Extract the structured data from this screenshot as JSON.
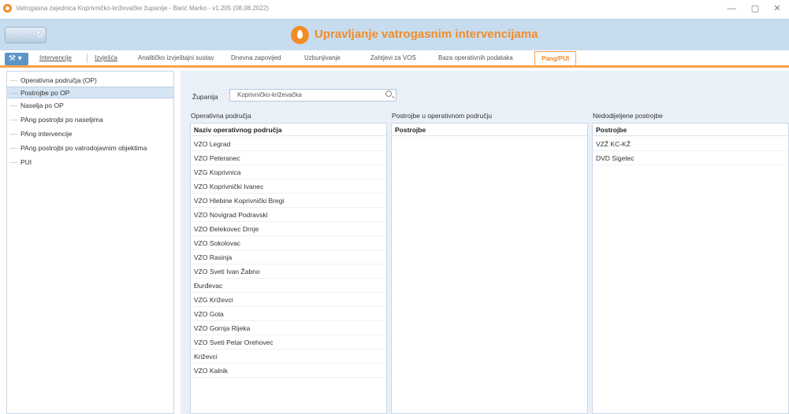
{
  "window": {
    "title": "Vatrogasna zajednica Koprivničko-križevačke županije - Barić Marko - v1.205 (08.08.2022)",
    "minimize": "—",
    "maximize": "▢",
    "close": "✕"
  },
  "header": {
    "back": "←",
    "forward": "→",
    "refresh": "↻",
    "title": "Upravljanje vatrogasnim intervencijama"
  },
  "tabs": {
    "tools": "⚒ ▾",
    "items": [
      "Intervencije",
      "Izvješća",
      "Analitičko izvještajni sustav",
      "Dnevna zapovijed",
      "Uzbunjivanje",
      "Zahtjevi za VOS",
      "Baza operativnih podataka",
      "Pang/PUI"
    ]
  },
  "sidebar": {
    "items": [
      "Operativna područja (OP)",
      "Postrojbe po OP",
      "Naselja po OP",
      "PAng postrojbi po naseljima",
      "PAng intervencije",
      "PAng postrojbi po vatrodojavnim objektima",
      "PUI"
    ]
  },
  "filter": {
    "label": "Županija",
    "value": "Koprivničko-križevačka"
  },
  "panels": {
    "areas": {
      "label": "Operativna područja",
      "header": "Naziv operativnog područja",
      "rows": [
        "VZO Legrad",
        "VZO Peteranec",
        "VZG Koprivnica",
        "VZO Koprivnički Ivanec",
        "VZO Hlebine Koprivnički Bregi",
        "VZO Novigrad Podravski",
        "VZO Đelekovec Drnje",
        "VZO Sokolovac",
        "VZO Rasinja",
        "VZO Sveti Ivan Žabno",
        "Đurđevac",
        "VZG Križevci",
        "VZO Gola",
        "VZO Gornja Rijeka",
        "VZO Sveti Petar Orehovec",
        "Križevci",
        "VZO Kalnik"
      ]
    },
    "units": {
      "label": "Postrojbe u operativnom području",
      "header": "Postrojbe",
      "rows": []
    },
    "unassigned": {
      "label": "Nedodijeljene postrojbe",
      "header": "Postrojbe",
      "rows": [
        "VZŽ KC-KŽ",
        "DVD Sigetec"
      ]
    }
  }
}
